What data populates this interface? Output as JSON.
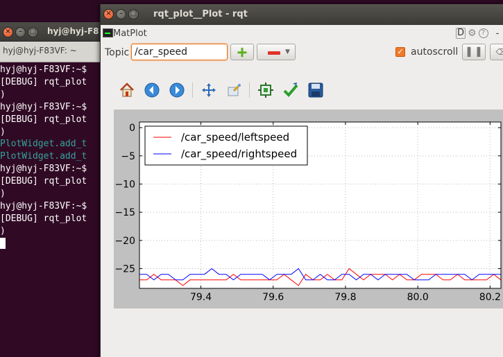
{
  "terminal": {
    "title": "hyj@hyj-F8",
    "tab_label": "hyj@hyj-F83VF: ~",
    "lines": [
      {
        "text": "hyj@hyj-F83VF:~$",
        "color": "#ffffff"
      },
      {
        "text": "[DEBUG] rqt_plot",
        "color": "#ffffff"
      },
      {
        "text": ")",
        "color": "#ffffff"
      },
      {
        "text": "hyj@hyj-F83VF:~$",
        "color": "#ffffff"
      },
      {
        "text": "[DEBUG] rqt_plot",
        "color": "#ffffff"
      },
      {
        "text": ")",
        "color": "#ffffff"
      },
      {
        "text": "PlotWidget.add_t",
        "color": "#34a39c"
      },
      {
        "text": "PlotWidget.add_t",
        "color": "#34a39c"
      },
      {
        "text": "hyj@hyj-F83VF:~$",
        "color": "#ffffff"
      },
      {
        "text": "[DEBUG] rqt_plot",
        "color": "#ffffff"
      },
      {
        "text": ")",
        "color": "#ffffff"
      },
      {
        "text": "hyj@hyj-F83VF:~$",
        "color": "#ffffff"
      },
      {
        "text": "[DEBUG] rqt_plot",
        "color": "#ffffff"
      },
      {
        "text": ")",
        "color": "#ffffff"
      }
    ]
  },
  "rqt": {
    "title": "rqt_plot__Plot - rqt",
    "plugin_label": "MatPlot",
    "d_label": "D",
    "help_label": "?",
    "dash_label": "-",
    "topic_label": "Topic",
    "topic_value": "/car_speed",
    "autoscroll_label": "autoscroll",
    "autoscroll_checked": true
  },
  "toolbar": {
    "icons": [
      "home-icon",
      "back-arrow-icon",
      "forward-arrow-icon",
      "pan-icon",
      "zoom-icon",
      "subplots-icon",
      "edit-check-icon",
      "save-icon"
    ]
  },
  "colors": {
    "leftspeed": "#ff0000",
    "rightspeed": "#0000ff",
    "accent": "#f07a2a"
  },
  "chart_data": {
    "type": "line",
    "title": "",
    "xlabel": "",
    "ylabel": "",
    "xlim": [
      79.23,
      80.23
    ],
    "ylim": [
      -28.5,
      1.0
    ],
    "x_ticks": [
      79.4,
      79.6,
      79.8,
      80.0,
      80.2
    ],
    "y_ticks": [
      0,
      -5,
      -10,
      -15,
      -20,
      -25
    ],
    "x_tick_labels": [
      "79.4",
      "79.6",
      "79.8",
      "80.0",
      "80.2"
    ],
    "y_tick_labels": [
      "0",
      "−5",
      "−10",
      "−15",
      "−20",
      "−25"
    ],
    "grid": true,
    "legend_position": "top-left",
    "series": [
      {
        "name": "/car_speed/leftspeed",
        "color": "#ff0000",
        "x": [
          79.23,
          79.25,
          79.27,
          79.29,
          79.31,
          79.33,
          79.35,
          79.37,
          79.39,
          79.41,
          79.43,
          79.45,
          79.47,
          79.49,
          79.51,
          79.53,
          79.55,
          79.57,
          79.59,
          79.61,
          79.63,
          79.65,
          79.67,
          79.69,
          79.71,
          79.73,
          79.75,
          79.77,
          79.79,
          79.81,
          79.83,
          79.85,
          79.87,
          79.89,
          79.91,
          79.93,
          79.95,
          79.97,
          79.99,
          80.01,
          80.03,
          80.05,
          80.07,
          80.09,
          80.11,
          80.13,
          80.15,
          80.17,
          80.19,
          80.21,
          80.23
        ],
        "y": [
          -27,
          -27,
          -26,
          -27,
          -27,
          -27,
          -28,
          -27,
          -27,
          -27,
          -27,
          -27,
          -27,
          -26,
          -27,
          -27,
          -27,
          -27,
          -27,
          -27,
          -26,
          -27,
          -28,
          -26,
          -27,
          -27,
          -26,
          -27,
          -27,
          -25,
          -26,
          -27,
          -26,
          -26,
          -26,
          -27,
          -26,
          -27,
          -27,
          -26,
          -26,
          -26,
          -27,
          -27,
          -26,
          -27,
          -27,
          -27,
          -27,
          -26,
          -27
        ]
      },
      {
        "name": "/car_speed/rightspeed",
        "color": "#0000ff",
        "x": [
          79.23,
          79.25,
          79.27,
          79.29,
          79.31,
          79.33,
          79.35,
          79.37,
          79.39,
          79.41,
          79.43,
          79.45,
          79.47,
          79.49,
          79.51,
          79.53,
          79.55,
          79.57,
          79.59,
          79.61,
          79.63,
          79.65,
          79.67,
          79.69,
          79.71,
          79.73,
          79.75,
          79.77,
          79.79,
          79.81,
          79.83,
          79.85,
          79.87,
          79.89,
          79.91,
          79.93,
          79.95,
          79.97,
          79.99,
          80.01,
          80.03,
          80.05,
          80.07,
          80.09,
          80.11,
          80.13,
          80.15,
          80.17,
          80.19,
          80.21,
          80.23
        ],
        "y": [
          -26,
          -26,
          -27,
          -26,
          -26,
          -27,
          -27,
          -26,
          -26,
          -26,
          -25,
          -26,
          -26,
          -27,
          -26,
          -26,
          -26,
          -26,
          -27,
          -26,
          -26,
          -26,
          -25,
          -27,
          -27,
          -26,
          -27,
          -27,
          -26,
          -26,
          -27,
          -26,
          -26,
          -27,
          -26,
          -26,
          -26,
          -26,
          -27,
          -27,
          -27,
          -26,
          -26,
          -26,
          -26,
          -26,
          -27,
          -26,
          -26,
          -26,
          -26
        ]
      }
    ]
  }
}
